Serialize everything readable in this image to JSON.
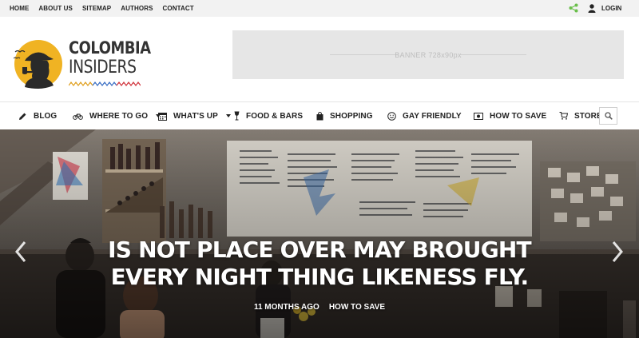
{
  "topnav": {
    "items": [
      "HOME",
      "ABOUT US",
      "SITEMAP",
      "AUTHORS",
      "CONTACT"
    ],
    "login_label": "LOGIN",
    "share_icon": "share-icon",
    "user_icon": "user-icon",
    "share_color": "#6abf4b"
  },
  "logo": {
    "line1": "COLOMBIA",
    "line2": "INSIDERS",
    "accent": "#f0b323"
  },
  "banner": {
    "text": "BANNER 728x90px"
  },
  "mainnav": {
    "items": [
      {
        "label": "BLOG",
        "icon": "pencil-icon",
        "dropdown": false
      },
      {
        "label": "WHERE TO GO",
        "icon": "bicycle-icon",
        "dropdown": true
      },
      {
        "label": "WHAT'S UP",
        "icon": "calendar-icon",
        "dropdown": true
      },
      {
        "label": "FOOD & BARS",
        "icon": "mic-icon",
        "dropdown": false
      },
      {
        "label": "SHOPPING",
        "icon": "bag-icon",
        "dropdown": false
      },
      {
        "label": "GAY FRIENDLY",
        "icon": "smile-icon",
        "dropdown": false
      },
      {
        "label": "HOW TO SAVE",
        "icon": "money-icon",
        "dropdown": false
      },
      {
        "label": "STORE",
        "icon": "cart-icon",
        "dropdown": false
      }
    ],
    "search_icon": "search-icon"
  },
  "hero": {
    "title": "IS NOT PLACE OVER MAY BROUGHT EVERY NIGHT THING LIKENESS FLY.",
    "time": "11 MONTHS AGO",
    "category": "HOW TO SAVE"
  }
}
